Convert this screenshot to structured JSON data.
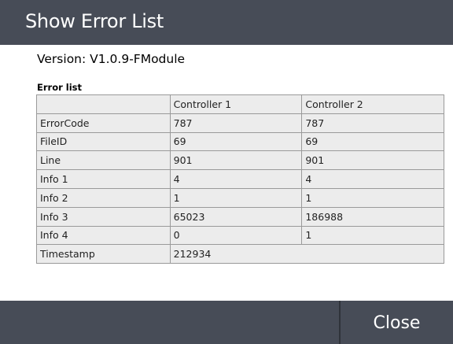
{
  "dialog": {
    "title": "Show Error List",
    "version": "Version: V1.0.9-FModule",
    "error_list_label": "Error list",
    "close_label": "Close"
  },
  "table": {
    "headers": [
      "",
      "Controller 1",
      "Controller 2"
    ],
    "rows": [
      {
        "label": "ErrorCode",
        "c1": "787",
        "c2": "787"
      },
      {
        "label": "FileID",
        "c1": "69",
        "c2": "69"
      },
      {
        "label": "Line",
        "c1": "901",
        "c2": "901"
      },
      {
        "label": "Info 1",
        "c1": "4",
        "c2": "4"
      },
      {
        "label": "Info 2",
        "c1": "1",
        "c2": "1"
      },
      {
        "label": "Info 3",
        "c1": "65023",
        "c2": "186988"
      },
      {
        "label": "Info 4",
        "c1": "0",
        "c2": "1"
      }
    ],
    "timestamp_label": "Timestamp",
    "timestamp_value": "212934"
  },
  "colors": {
    "titlebar": "#474c57",
    "table_bg": "#ececec",
    "table_border": "#9a9a9a"
  }
}
